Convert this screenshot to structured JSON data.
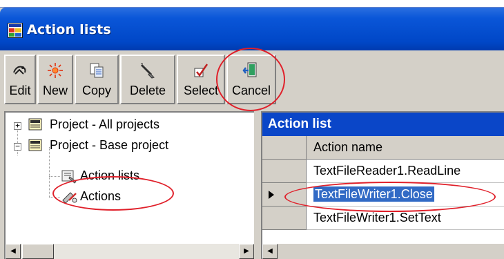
{
  "window": {
    "title": "Action lists"
  },
  "toolbar": {
    "buttons": [
      {
        "label": "Edit",
        "icon": "edit-icon"
      },
      {
        "label": "New",
        "icon": "new-icon"
      },
      {
        "label": "Copy",
        "icon": "copy-icon"
      },
      {
        "label": "Delete",
        "icon": "delete-icon"
      },
      {
        "label": "Select",
        "icon": "select-icon"
      },
      {
        "label": "Cancel",
        "icon": "cancel-icon"
      }
    ]
  },
  "tree": {
    "nodes": [
      {
        "label": "Project - All projects",
        "expander": "+"
      },
      {
        "label": "Project - Base project",
        "expander": "−"
      },
      {
        "label": "Action lists"
      },
      {
        "label": "Actions"
      }
    ]
  },
  "grid": {
    "caption": "Action list",
    "column_header": "Action name",
    "rows": [
      {
        "name": "TextFileReader1.ReadLine",
        "selected": false
      },
      {
        "name": "TextFileWriter1.Close",
        "selected": true
      },
      {
        "name": "TextFileWriter1.SetText",
        "selected": false
      }
    ]
  },
  "colors": {
    "titlebar": "#0a56d8",
    "grid_caption": "#0a46c8",
    "selection": "#316ac5",
    "annotation": "#e0202a"
  }
}
